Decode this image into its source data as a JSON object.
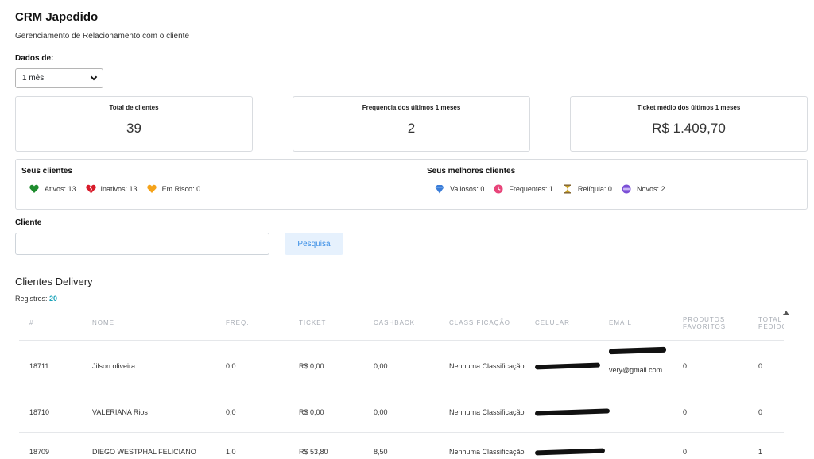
{
  "header": {
    "title": "CRM Japedido",
    "subtitle": "Gerenciamento de Relacionamento com o cliente"
  },
  "filter": {
    "label": "Dados de:",
    "selected": "1 mês"
  },
  "stats": [
    {
      "label": "Total de clientes",
      "value": "39"
    },
    {
      "label": "Frequencia dos últimos 1 meses",
      "value": "2"
    },
    {
      "label": "Ticket médio dos últimos 1 meses",
      "value": "R$ 1.409,70"
    }
  ],
  "your_clients": {
    "title": "Seus clientes",
    "items": [
      {
        "label": "Ativos: 13",
        "icon": "green-heart-icon",
        "color": "#1e8c2e"
      },
      {
        "label": "Inativos: 13",
        "icon": "broken-heart-icon",
        "color": "#d81b2a"
      },
      {
        "label": "Em Risco: 0",
        "icon": "orange-heart-icon",
        "color": "#f5a31a"
      }
    ]
  },
  "best_clients": {
    "title": "Seus melhores clientes",
    "items": [
      {
        "label": "Valiosos: 0",
        "icon": "diamond-icon",
        "color": "#3b7dd8"
      },
      {
        "label": "Frequentes: 1",
        "icon": "clock-icon",
        "color": "#e8457a"
      },
      {
        "label": "Relíquia: 0",
        "icon": "hourglass-icon",
        "color": "#c9a227"
      },
      {
        "label": "Novos: 2",
        "icon": "new-badge-icon",
        "color": "#7b4fd6"
      }
    ]
  },
  "search": {
    "label": "Cliente",
    "value": "",
    "button": "Pesquisa"
  },
  "table": {
    "title": "Clientes Delivery",
    "records_label": "Registros:",
    "records_count": "20",
    "columns": [
      "#",
      "NOME",
      "FREQ.",
      "TICKET",
      "CASHBACK",
      "CLASSIFICAÇÃO",
      "CELULAR",
      "EMAIL",
      "PRODUTOS FAVORITOS",
      "TOTAL PEDIDOS"
    ],
    "rows": [
      {
        "id": "18711",
        "name": "Jilson oliveira",
        "freq": "0,0",
        "ticket": "R$ 0,00",
        "cashback": "0,00",
        "class": "Nenhuma Classificação",
        "email": "very@gmail.com",
        "favorites": "0",
        "total": "0"
      },
      {
        "id": "18710",
        "name": "VALERIANA Rios",
        "freq": "0,0",
        "ticket": "R$ 0,00",
        "cashback": "0,00",
        "class": "Nenhuma Classificação",
        "email": "",
        "favorites": "0",
        "total": "0"
      },
      {
        "id": "18709",
        "name": "DIEGO WESTPHAL FELICIANO",
        "freq": "1,0",
        "ticket": "R$ 53,80",
        "cashback": "8,50",
        "class": "Nenhuma Classificação",
        "email": "",
        "favorites": "0",
        "total": "1"
      }
    ]
  }
}
